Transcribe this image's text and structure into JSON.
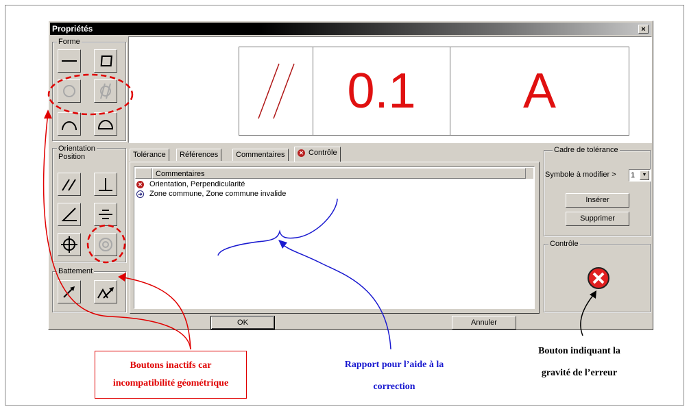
{
  "dialog": {
    "title": "Propriétés",
    "close_label": "×",
    "groups": {
      "forme": "Forme",
      "orientation": "Orientation\nPosition",
      "battement": "Battement"
    },
    "frame": {
      "symbol": "//",
      "tolerance": "0.1",
      "datum": "A"
    },
    "tabs": [
      {
        "label": "Tolérance"
      },
      {
        "label": "Références"
      },
      {
        "label": "Commentaires"
      },
      {
        "label": "Contrôle",
        "icon": "error-icon"
      }
    ],
    "report": {
      "column_header": "Commentaires",
      "rows": [
        {
          "icon": "error-icon",
          "text": "Orientation, Perpendicularité"
        },
        {
          "icon": "arrow-right-icon",
          "text": "Zone commune, Zone commune invalide"
        }
      ]
    },
    "cadre": {
      "title": "Cadre de tolérance",
      "symbol_label": "Symbole à modifier >",
      "symbol_value": "1",
      "insert_label": "Insérer",
      "delete_label": "Supprimer"
    },
    "controle": {
      "title": "Contrôle",
      "severity_icon": "error-icon"
    },
    "ok_label": "OK",
    "cancel_label": "Annuler"
  },
  "annotations": {
    "inactive_line1": "Boutons inactifs car",
    "inactive_line2": "incompatibilité géométrique",
    "report_line1": "Rapport pour l’aide à la",
    "report_line2": "correction",
    "severity_line1": "Bouton indiquant la",
    "severity_line2": "gravité de l’erreur"
  },
  "colors": {
    "accent_red": "#e01010",
    "annotation_blue": "#1a1ad0",
    "annotation_red": "#e00000",
    "dialog_face": "#d4d0c8"
  }
}
